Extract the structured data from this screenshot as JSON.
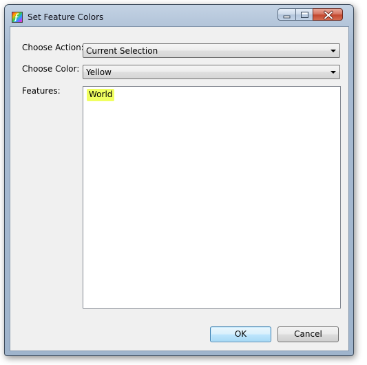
{
  "window": {
    "title": "Set Feature Colors",
    "app_icon": "feature-colors-app-icon",
    "caption_buttons": [
      "minimize",
      "maximize",
      "close"
    ]
  },
  "form": {
    "action": {
      "label": "Choose Action:",
      "selected": "Current Selection"
    },
    "color": {
      "label": "Choose Color:",
      "selected": "Yellow"
    },
    "features": {
      "label": "Features:",
      "items": [
        {
          "text": "World",
          "highlight_color": "#f0ff60"
        }
      ]
    }
  },
  "buttons": {
    "ok_label": "OK",
    "cancel_label": "Cancel"
  },
  "colors": {
    "client_background": "#f0f0f0",
    "highlight_yellow": "#f0ff60",
    "ok_button_border": "#3c7fb1"
  }
}
